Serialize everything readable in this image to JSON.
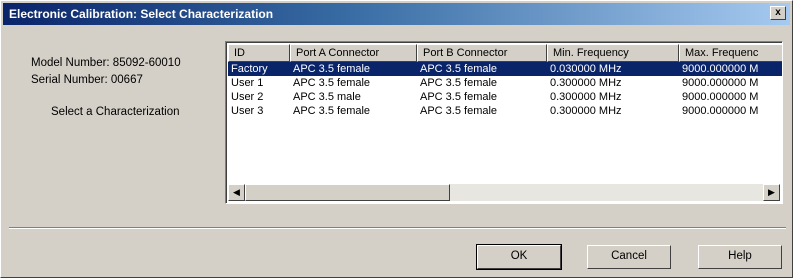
{
  "window": {
    "title": "Electronic Calibration: Select Characterization",
    "close_label": "x"
  },
  "info": {
    "model": "Model Number: 85092-60010",
    "serial": "Serial Number: 00667",
    "select_label": "Select a Characterization"
  },
  "table": {
    "columns": [
      "ID",
      "Port A Connector",
      "Port B Connector",
      "Min. Frequency",
      "Max. Frequenc"
    ],
    "rows": [
      [
        "Factory",
        "APC 3.5 female",
        "APC 3.5 female",
        "0.030000 MHz",
        "9000.000000 M"
      ],
      [
        "User 1",
        "APC 3.5 female",
        "APC 3.5 female",
        "0.300000 MHz",
        "9000.000000 M"
      ],
      [
        "User 2",
        "APC 3.5 male",
        "APC 3.5 female",
        "0.300000 MHz",
        "9000.000000 M"
      ],
      [
        "User 3",
        "APC 3.5 female",
        "APC 3.5 female",
        "0.300000 MHz",
        "9000.000000 M"
      ]
    ],
    "selected_row": 0
  },
  "scrollbar": {
    "left_arrow": "◀",
    "right_arrow": "▶"
  },
  "buttons": {
    "ok": "OK",
    "cancel": "Cancel",
    "help": "Help"
  }
}
